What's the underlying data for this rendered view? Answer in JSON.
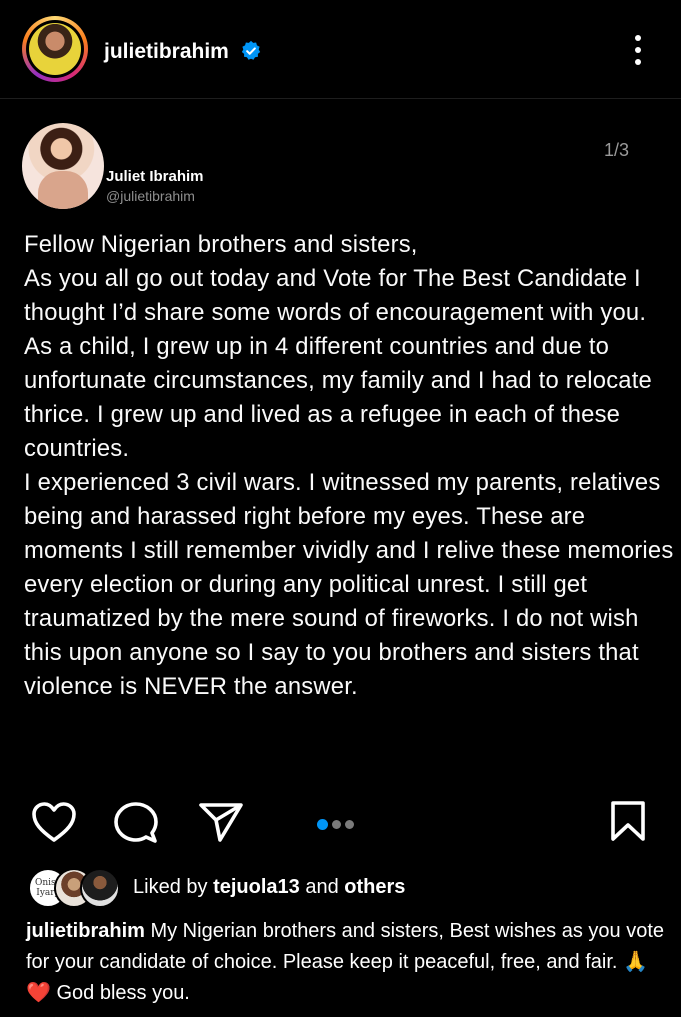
{
  "header": {
    "username": "julietibrahim",
    "verified_icon": "verified-badge-icon",
    "more_icon": "more-vertical-icon"
  },
  "post": {
    "pager": "1/3",
    "tweet": {
      "display_name": "Juliet Ibrahim",
      "handle": "@julietibrahim",
      "paragraphs": [
        "Fellow Nigerian brothers and sisters,",
        "As you all go out today and Vote for The Best Candidate I thought I’d share some words of encouragement with you.",
        "As a child, I grew up in 4 different countries and due to unfortunate circumstances, my family and I had to relocate thrice. I grew up and lived as a refugee in each of these countries.",
        "I experienced 3 civil wars. I witnessed my parents, relatives being and harassed right before my eyes. These are moments I still remember vividly and I relive these memories every election or during any political unrest. I still get traumatized by the mere sound of fireworks. I do not wish this upon anyone so I say to you brothers and sisters that violence is NEVER the answer."
      ]
    },
    "carousel": {
      "total": 3,
      "current": 1
    }
  },
  "actions": {
    "like_icon": "heart-icon",
    "comment_icon": "comment-icon",
    "share_icon": "send-icon",
    "save_icon": "bookmark-icon"
  },
  "likes": {
    "prefix": "Liked by",
    "user": "tejuola13",
    "joiner": "and",
    "suffix": "others",
    "liker_badge_text": "Onise Iyary"
  },
  "caption": {
    "username": "julietibrahim",
    "text": "My Nigerian brothers and sisters, Best wishes as you vote for your candidate of choice. Please keep it peaceful, free, and fair. 🙏❤️ God bless you."
  },
  "colors": {
    "accent": "#0095f6",
    "background": "#000000",
    "secondary_text": "#8e8e8e"
  }
}
